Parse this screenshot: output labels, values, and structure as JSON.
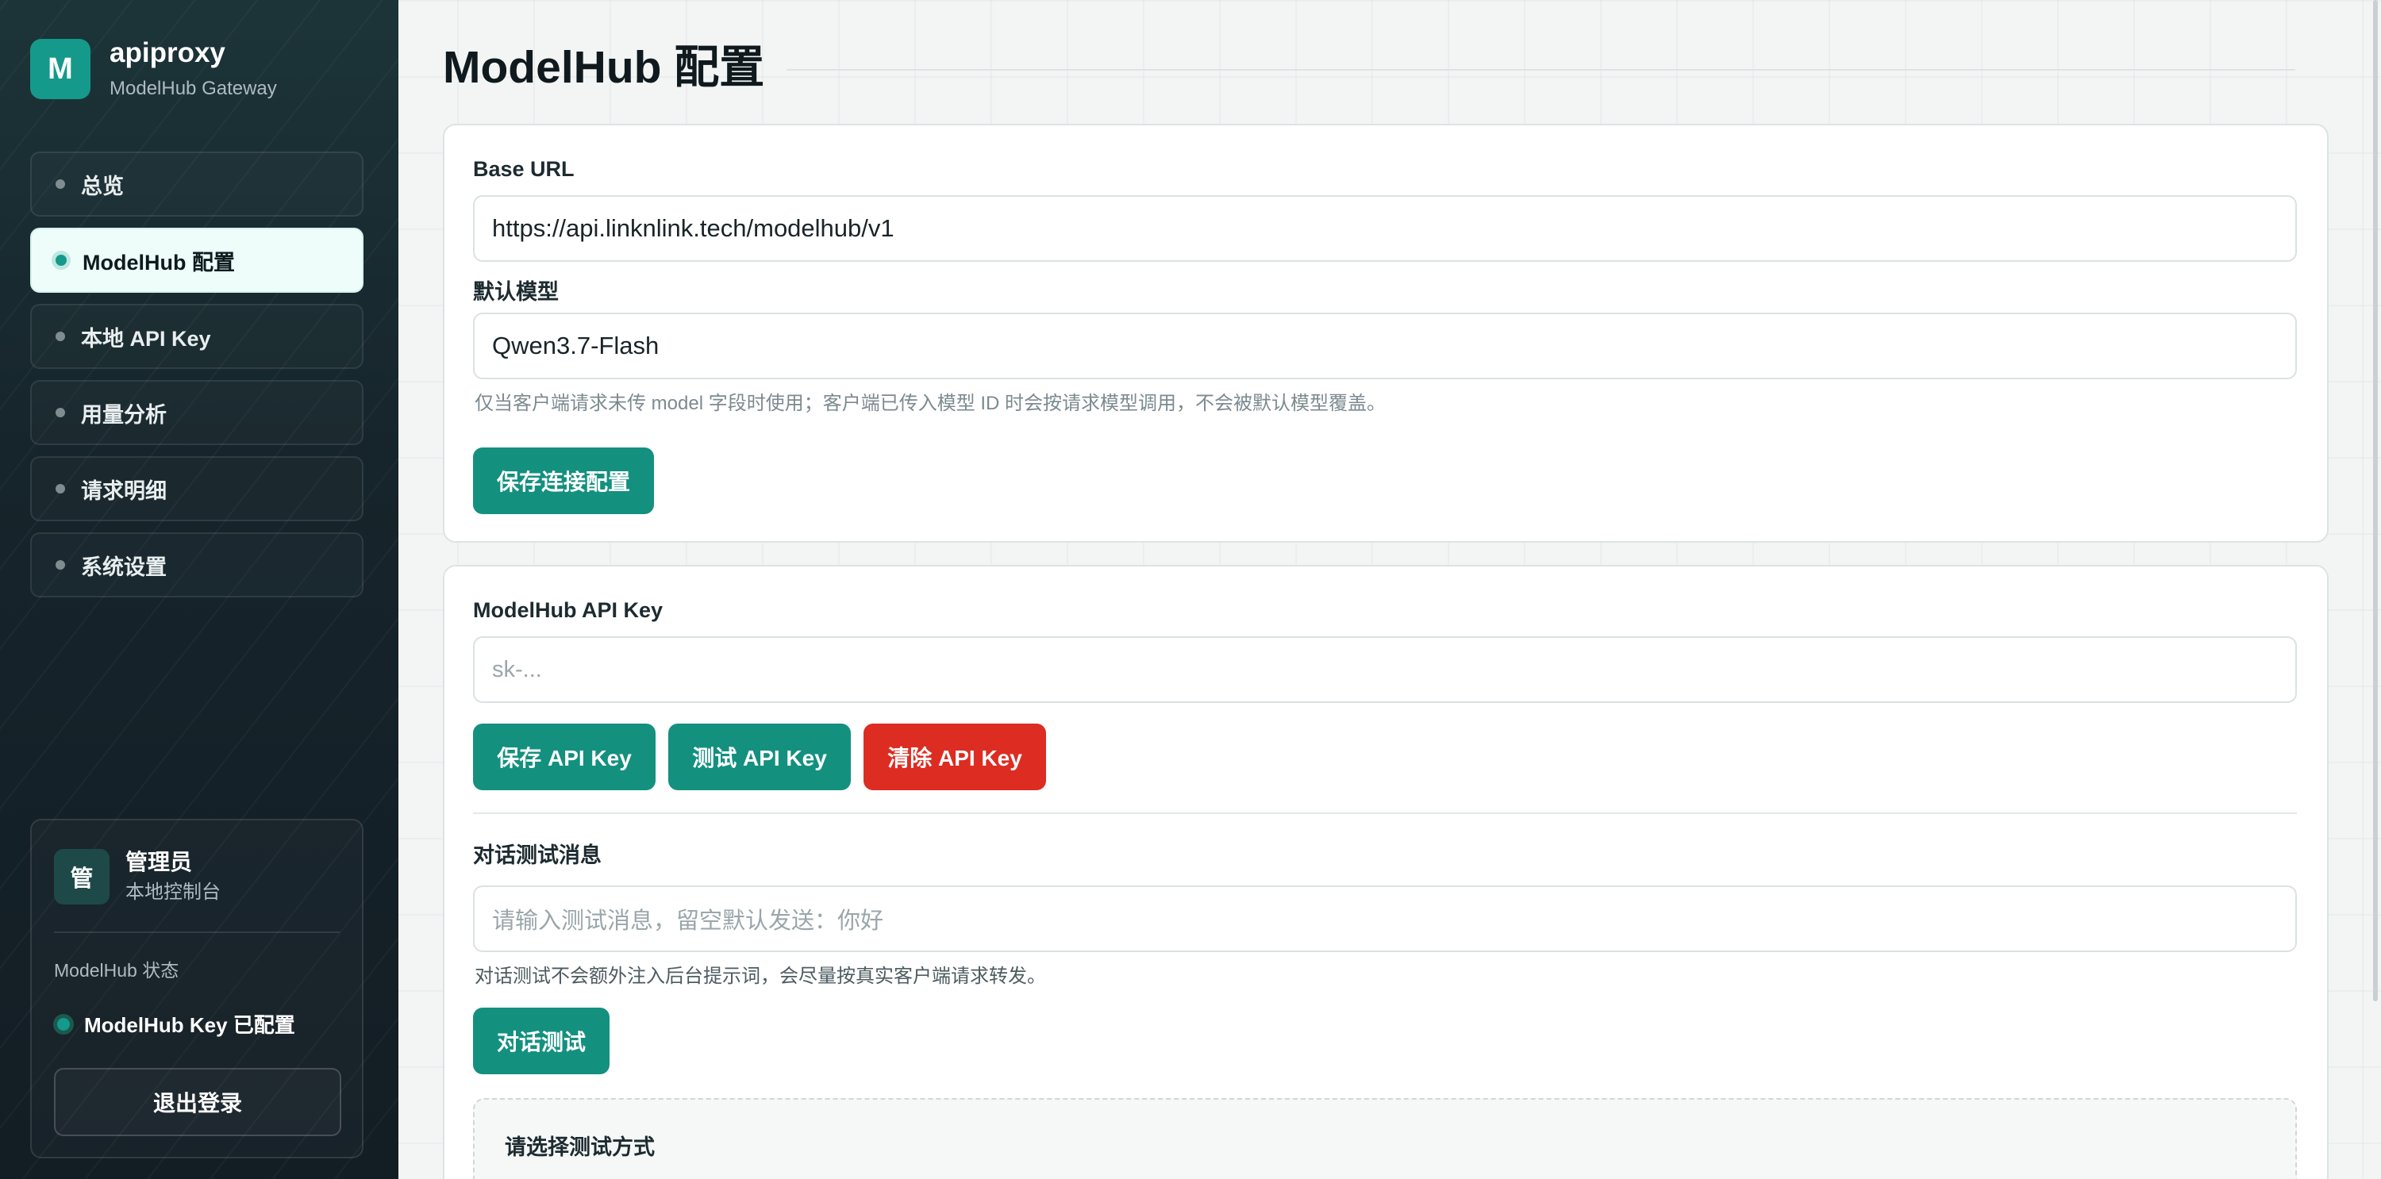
{
  "brand": {
    "logo": "M",
    "title": "apiproxy",
    "subtitle": "ModelHub Gateway"
  },
  "nav": {
    "items": [
      {
        "label": "总览",
        "active": false
      },
      {
        "label": "ModelHub 配置",
        "active": true
      },
      {
        "label": "本地 API Key",
        "active": false
      },
      {
        "label": "用量分析",
        "active": false
      },
      {
        "label": "请求明细",
        "active": false
      },
      {
        "label": "系统设置",
        "active": false
      }
    ]
  },
  "user": {
    "avatar": "管",
    "name": "管理员",
    "role": "本地控制台",
    "status_label": "ModelHub 状态",
    "status_text": "ModelHub Key 已配置",
    "logout_label": "退出登录"
  },
  "page": {
    "title": "ModelHub 配置"
  },
  "connection": {
    "base_url_label": "Base URL",
    "base_url_value": "https://api.linknlink.tech/modelhub/v1",
    "model_label": "默认模型",
    "model_value": "Qwen3.7-Flash",
    "model_hint": "仅当客户端请求未传 model 字段时使用；客户端已传入模型 ID 时会按请求模型调用，不会被默认模型覆盖。",
    "save_label": "保存连接配置"
  },
  "apikey": {
    "label": "ModelHub API Key",
    "placeholder": "sk-...",
    "save_label": "保存 API Key",
    "test_label": "测试 API Key",
    "clear_label": "清除 API Key"
  },
  "chat_test": {
    "label": "对话测试消息",
    "placeholder": "请输入测试消息，留空默认发送：你好",
    "hint": "对话测试不会额外注入后台提示词，会尽量按真实客户端请求转发。",
    "button_label": "对话测试",
    "result_title": "请选择测试方式"
  },
  "colors": {
    "accent": "#14907f",
    "danger": "#dd2c22",
    "sidebar_bg": "#16222a",
    "active_nav_bg": "#effdfa"
  }
}
